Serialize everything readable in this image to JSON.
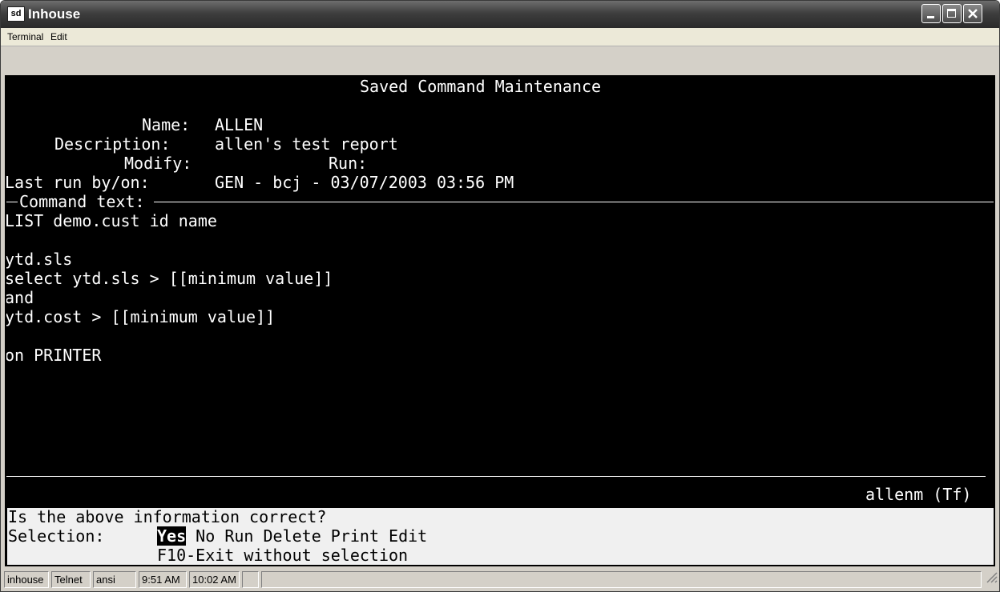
{
  "window": {
    "title": "Inhouse",
    "icon_label": "sd"
  },
  "menu": {
    "terminal": "Terminal",
    "edit": "Edit"
  },
  "screen": {
    "heading": "Saved Command Maintenance",
    "fields": {
      "name_label": "Name:",
      "name_value": "ALLEN",
      "description_label": "Description:",
      "description_value": "allen's test report",
      "modify_label": "Modify:",
      "run_label": "Run:",
      "last_run_label": "Last run by/on:",
      "last_run_value": "GEN - bcj - 03/07/2003 03:56 PM"
    },
    "command_text_label": "Command text:",
    "command_lines": [
      "LIST demo.cust id name",
      "ytd.sls",
      "select ytd.sls > [[minimum value]]",
      "and",
      "ytd.cost > [[minimum value]]",
      "on PRINTER"
    ],
    "user_tag": "allenm (Tf)"
  },
  "prompt": {
    "question": "Is the above information correct?",
    "selection_label": "Selection:",
    "options": {
      "yes": "Yes",
      "no": "No",
      "run": "Run",
      "delete": "Delete",
      "print": "Print",
      "edit": "Edit"
    },
    "exit_hint": "F10-Exit without selection"
  },
  "status": {
    "host": "inhouse",
    "protocol": "Telnet",
    "emulation": "ansi",
    "time_start": "9:51 AM",
    "time_now": "10:02 AM"
  }
}
